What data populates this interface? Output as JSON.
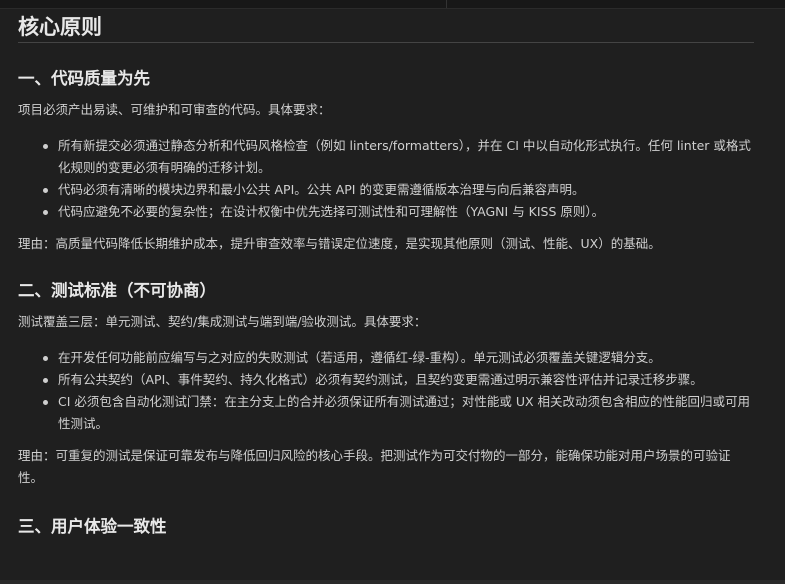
{
  "document": {
    "title": "核心原则",
    "sections": [
      {
        "heading": "一、代码质量为先",
        "intro": "项目必须产出易读、可维护和可审查的代码。具体要求：",
        "items": [
          "所有新提交必须通过静态分析和代码风格检查（例如 linters/formatters），并在 CI 中以自动化形式执行。任何 linter 或格式化规则的变更必须有明确的迁移计划。",
          "代码必须有清晰的模块边界和最小公共 API。公共 API 的变更需遵循版本治理与向后兼容声明。",
          "代码应避免不必要的复杂性；在设计权衡中优先选择可测试性和可理解性（YAGNI 与 KISS 原则）。"
        ],
        "reason": "理由：高质量代码降低长期维护成本，提升审查效率与错误定位速度，是实现其他原则（测试、性能、UX）的基础。"
      },
      {
        "heading": "二、测试标准（不可协商）",
        "intro": "测试覆盖三层：单元测试、契约/集成测试与端到端/验收测试。具体要求：",
        "items": [
          "在开发任何功能前应编写与之对应的失败测试（若适用，遵循红-绿-重构）。单元测试必须覆盖关键逻辑分支。",
          "所有公共契约（API、事件契约、持久化格式）必须有契约测试，且契约变更需通过明示兼容性评估并记录迁移步骤。",
          "CI 必须包含自动化测试门禁：在主分支上的合并必须保证所有测试通过；对性能或 UX 相关改动须包含相应的性能回归或可用性测试。"
        ],
        "reason": "理由：可重复的测试是保证可靠发布与降低回归风险的核心手段。把测试作为可交付物的一部分，能确保功能对用户场景的可验证性。"
      },
      {
        "heading": "三、用户体验一致性"
      }
    ]
  }
}
